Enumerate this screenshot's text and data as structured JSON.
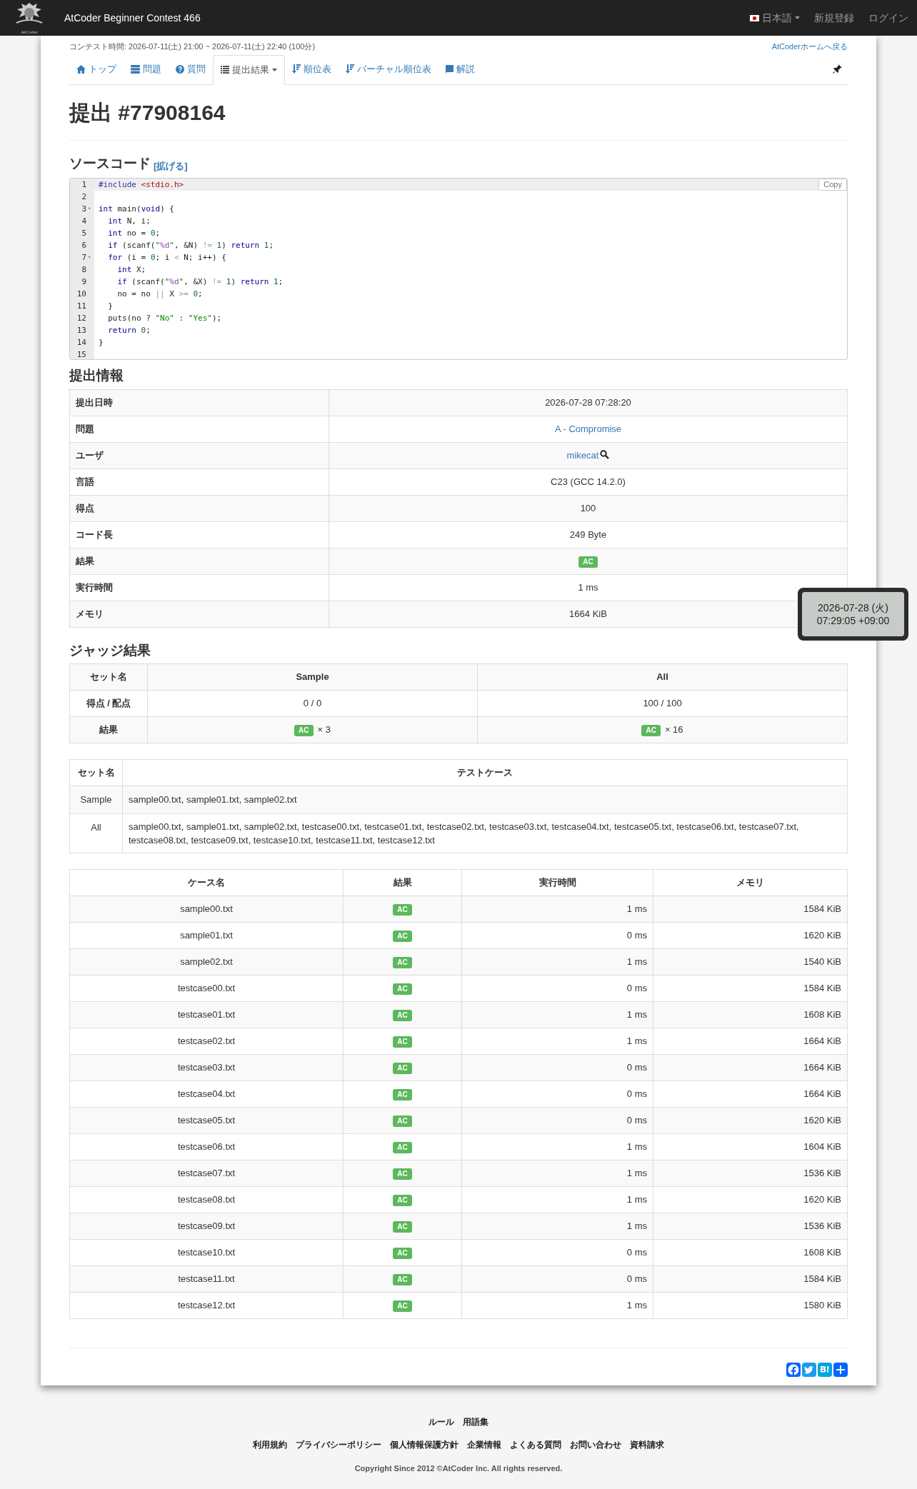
{
  "header": {
    "logo_text": "AtCoder",
    "contest_title": "AtCoder Beginner Contest 466",
    "language": "日本語",
    "links": [
      "新規登録",
      "ログイン"
    ]
  },
  "contest_time": "コンテスト時間: 2026-07-11(土) 21:00 ~ 2026-07-11(土) 22:40 (100分)",
  "home_link": "AtCoderホームへ戻る",
  "tabs": [
    {
      "label": "トップ",
      "kind": "home",
      "selected": false,
      "dropdown": false
    },
    {
      "label": "問題",
      "kind": "tasks",
      "selected": false,
      "dropdown": false
    },
    {
      "label": "質問",
      "kind": "question",
      "selected": false,
      "dropdown": false
    },
    {
      "label": "提出結果",
      "kind": "list",
      "selected": true,
      "dropdown": true
    },
    {
      "label": "順位表",
      "kind": "sort",
      "selected": false,
      "dropdown": false
    },
    {
      "label": "バーチャル順位表",
      "kind": "sort",
      "selected": false,
      "dropdown": false
    },
    {
      "label": "解説",
      "kind": "book",
      "selected": false,
      "dropdown": false
    }
  ],
  "page_title": "提出 #77908164",
  "source": {
    "heading": "ソースコード",
    "expand": "[拡げる]",
    "copy": "Copy",
    "lines": [
      {
        "n": "1",
        "tokens": [
          {
            "kind": "pre",
            "text": "#include"
          },
          {
            "kind": "inc",
            "text": " <stdio.h>"
          }
        ]
      },
      {
        "n": "2"
      },
      {
        "n": "3",
        "fold_marker": "▾",
        "tokens": [
          {
            "kind": "kw",
            "text": "int"
          },
          {
            "kind": "txt",
            "text": " main("
          },
          {
            "kind": "kw",
            "text": "void"
          },
          {
            "kind": "txt",
            "text": ") {"
          }
        ]
      },
      {
        "n": "4",
        "tokens": [
          {
            "kind": "kw",
            "text": "  int"
          },
          {
            "kind": "txt",
            "text": " N, i;"
          }
        ]
      },
      {
        "n": "5",
        "tokens": [
          {
            "kind": "kw",
            "text": "  int"
          },
          {
            "kind": "txt",
            "text": " no = "
          },
          {
            "kind": "num",
            "text": "0"
          },
          {
            "kind": "txt",
            "text": ";"
          }
        ]
      },
      {
        "n": "6",
        "tokens": [
          {
            "kind": "kw",
            "text": "  if"
          },
          {
            "kind": "txt",
            "text": " (scanf("
          },
          {
            "kind": "str",
            "text": "\""
          },
          {
            "kind": "fmt",
            "text": "%d"
          },
          {
            "kind": "str",
            "text": "\""
          },
          {
            "kind": "txt",
            "text": ", &N) "
          },
          {
            "kind": "op",
            "text": "!="
          },
          {
            "kind": "num",
            "text": " 1"
          },
          {
            "kind": "txt",
            "text": ") "
          },
          {
            "kind": "kw",
            "text": "return"
          },
          {
            "kind": "num",
            "text": " 1"
          },
          {
            "kind": "txt",
            "text": ";"
          }
        ]
      },
      {
        "n": "7",
        "fold_marker": "▾",
        "tokens": [
          {
            "kind": "kw",
            "text": "  for"
          },
          {
            "kind": "txt",
            "text": " (i = "
          },
          {
            "kind": "num",
            "text": "0"
          },
          {
            "kind": "txt",
            "text": "; i "
          },
          {
            "kind": "op",
            "text": "<"
          },
          {
            "kind": "txt",
            "text": " N; i++) {"
          }
        ]
      },
      {
        "n": "8",
        "tokens": [
          {
            "kind": "kw",
            "text": "    int"
          },
          {
            "kind": "txt",
            "text": " X;"
          }
        ]
      },
      {
        "n": "9",
        "tokens": [
          {
            "kind": "kw",
            "text": "    if"
          },
          {
            "kind": "txt",
            "text": " (scanf("
          },
          {
            "kind": "str",
            "text": "\""
          },
          {
            "kind": "fmt",
            "text": "%d"
          },
          {
            "kind": "str",
            "text": "\""
          },
          {
            "kind": "txt",
            "text": ", &X) "
          },
          {
            "kind": "op",
            "text": "!="
          },
          {
            "kind": "num",
            "text": " 1"
          },
          {
            "kind": "txt",
            "text": ") "
          },
          {
            "kind": "kw",
            "text": "return"
          },
          {
            "kind": "num",
            "text": " 1"
          },
          {
            "kind": "txt",
            "text": ";"
          }
        ]
      },
      {
        "n": "10",
        "tokens": [
          {
            "kind": "txt",
            "text": "    no = no "
          },
          {
            "kind": "op",
            "text": "||"
          },
          {
            "kind": "txt",
            "text": " X "
          },
          {
            "kind": "op",
            "text": ">="
          },
          {
            "kind": "num",
            "text": " 0"
          },
          {
            "kind": "txt",
            "text": ";"
          }
        ]
      },
      {
        "n": "11",
        "tokens": [
          {
            "kind": "txt",
            "text": "  }"
          }
        ]
      },
      {
        "n": "12",
        "tokens": [
          {
            "kind": "txt",
            "text": "  puts(no ? "
          },
          {
            "kind": "str",
            "text": "\"No\""
          },
          {
            "kind": "txt",
            "text": " : "
          },
          {
            "kind": "str",
            "text": "\"Yes\""
          },
          {
            "kind": "txt",
            "text": ");"
          }
        ]
      },
      {
        "n": "13",
        "tokens": [
          {
            "kind": "kw",
            "text": "  return"
          },
          {
            "kind": "num",
            "text": " 0"
          },
          {
            "kind": "txt",
            "text": ";"
          }
        ]
      },
      {
        "n": "14",
        "tokens": [
          {
            "kind": "txt",
            "text": "}"
          }
        ]
      },
      {
        "n": "15"
      }
    ]
  },
  "info": {
    "heading": "提出情報",
    "rows": [
      {
        "label": "提出日時",
        "kind": "text",
        "value": "2026-07-28 07:28:20"
      },
      {
        "label": "問題",
        "kind": "link",
        "value": "A - Compromise"
      },
      {
        "label": "ユーザ",
        "kind": "user",
        "value": "mikecat"
      },
      {
        "label": "言語",
        "kind": "text",
        "value": "C23 (GCC 14.2.0)"
      },
      {
        "label": "得点",
        "kind": "text",
        "value": "100"
      },
      {
        "label": "コード長",
        "kind": "text",
        "value": "249 Byte"
      },
      {
        "label": "結果",
        "kind": "badge",
        "value": "AC"
      },
      {
        "label": "実行時間",
        "kind": "text",
        "value": "1 ms"
      },
      {
        "label": "メモリ",
        "kind": "text",
        "value": "1664 KiB"
      }
    ]
  },
  "clock_overlay": {
    "date": "2026-07-28 (火)",
    "time": "07:29:05 +09:00"
  },
  "judge": {
    "heading": "ジャッジ結果",
    "columns": [
      "セット名",
      "Sample",
      "All"
    ],
    "score_row": {
      "label": "得点 / 配点",
      "values": [
        "0 / 0",
        "100 / 100"
      ]
    },
    "result_row": {
      "label": "結果",
      "cells": [
        {
          "badge": "AC",
          "count": "× 3"
        },
        {
          "badge": "AC",
          "count": "× 16"
        }
      ]
    }
  },
  "testcase_sets": {
    "columns": [
      "セット名",
      "テストケース"
    ],
    "rows": [
      {
        "set": "Sample",
        "cases": "sample00.txt, sample01.txt, sample02.txt"
      },
      {
        "set": "All",
        "cases": "sample00.txt, sample01.txt, sample02.txt, testcase00.txt, testcase01.txt, testcase02.txt, testcase03.txt, testcase04.txt, testcase05.txt, testcase06.txt, testcase07.txt, testcase08.txt, testcase09.txt, testcase10.txt, testcase11.txt, testcase12.txt"
      }
    ]
  },
  "cases": {
    "columns": [
      "ケース名",
      "結果",
      "実行時間",
      "メモリ"
    ],
    "rows": [
      [
        "sample00.txt",
        "AC",
        "1 ms",
        "1584 KiB"
      ],
      [
        "sample01.txt",
        "AC",
        "0 ms",
        "1620 KiB"
      ],
      [
        "sample02.txt",
        "AC",
        "1 ms",
        "1540 KiB"
      ],
      [
        "testcase00.txt",
        "AC",
        "0 ms",
        "1584 KiB"
      ],
      [
        "testcase01.txt",
        "AC",
        "1 ms",
        "1608 KiB"
      ],
      [
        "testcase02.txt",
        "AC",
        "1 ms",
        "1664 KiB"
      ],
      [
        "testcase03.txt",
        "AC",
        "0 ms",
        "1664 KiB"
      ],
      [
        "testcase04.txt",
        "AC",
        "0 ms",
        "1664 KiB"
      ],
      [
        "testcase05.txt",
        "AC",
        "0 ms",
        "1620 KiB"
      ],
      [
        "testcase06.txt",
        "AC",
        "1 ms",
        "1604 KiB"
      ],
      [
        "testcase07.txt",
        "AC",
        "1 ms",
        "1536 KiB"
      ],
      [
        "testcase08.txt",
        "AC",
        "1 ms",
        "1620 KiB"
      ],
      [
        "testcase09.txt",
        "AC",
        "1 ms",
        "1536 KiB"
      ],
      [
        "testcase10.txt",
        "AC",
        "0 ms",
        "1608 KiB"
      ],
      [
        "testcase11.txt",
        "AC",
        "0 ms",
        "1584 KiB"
      ],
      [
        "testcase12.txt",
        "AC",
        "1 ms",
        "1580 KiB"
      ]
    ]
  },
  "share": [
    {
      "kind": "facebook"
    },
    {
      "kind": "twitter"
    },
    {
      "kind": "hatena"
    },
    {
      "kind": "add"
    }
  ],
  "footer": {
    "link_rows": [
      [
        "ルール",
        "用語集"
      ],
      [
        "利用規約",
        "プライバシーポリシー",
        "個人情報保護方針",
        "企業情報",
        "よくある質問",
        "お問い合わせ",
        "資料請求"
      ]
    ],
    "copyright": "Copyright Since 2012 **©AtCoder Inc.** All rights reserved."
  }
}
